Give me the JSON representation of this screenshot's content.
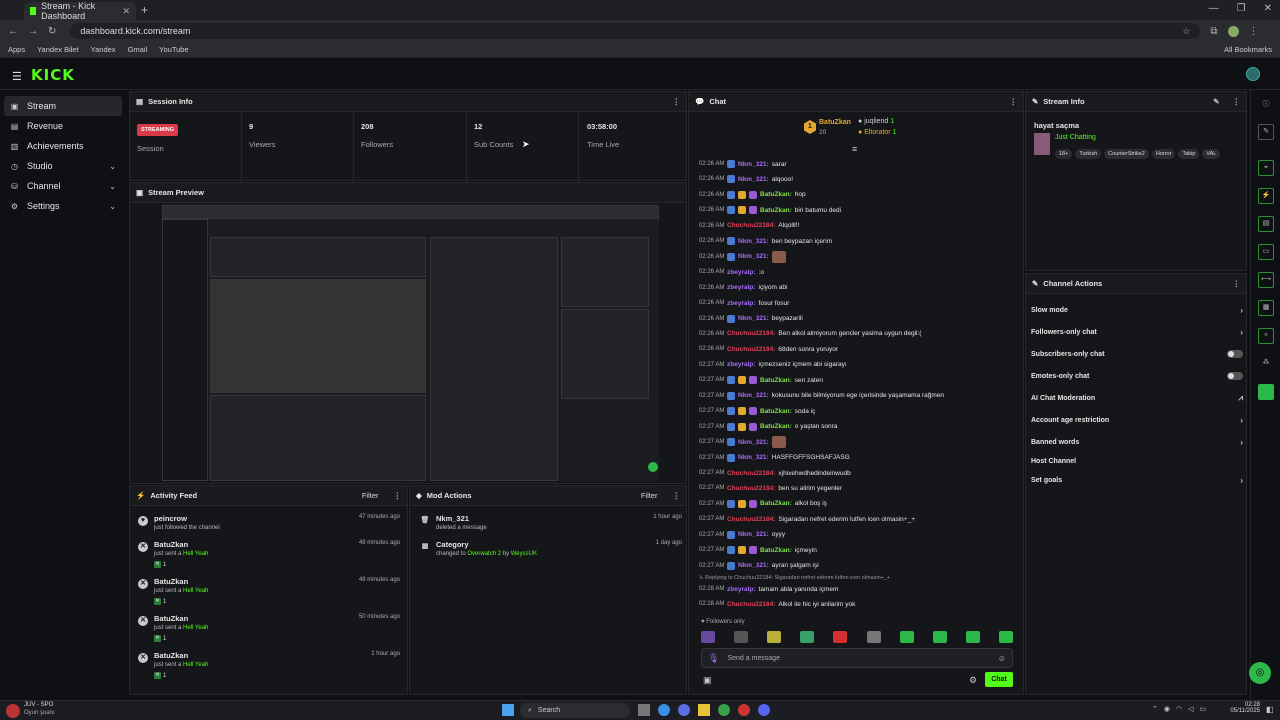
{
  "browser": {
    "tab_title": "Stream - Kick Dashboard",
    "url": "dashboard.kick.com/stream",
    "bookmarks": [
      "Apps",
      "Yandex Bilet",
      "Yandex",
      "Gmail",
      "YouTube"
    ],
    "all_bookmarks": "All Bookmarks"
  },
  "logo": "KICK",
  "sidebar": {
    "items": [
      {
        "label": "Stream",
        "icon": "video-icon"
      },
      {
        "label": "Revenue",
        "icon": "wallet-icon"
      },
      {
        "label": "Achievements",
        "icon": "trophy-icon"
      },
      {
        "label": "Studio",
        "icon": "studio-icon"
      },
      {
        "label": "Channel",
        "icon": "channel-icon"
      },
      {
        "label": "Settings",
        "icon": "gear-icon"
      }
    ]
  },
  "session": {
    "title": "Session Info",
    "badge": "STREAMING",
    "session_label": "Session",
    "stats": [
      {
        "value": "9",
        "label": "Viewers"
      },
      {
        "value": "208",
        "label": "Followers"
      },
      {
        "value": "12",
        "label": "Sub Counts"
      },
      {
        "value": "03:58:00",
        "label": "Time Live"
      }
    ]
  },
  "preview": {
    "title": "Stream Preview"
  },
  "activity": {
    "title": "Activity Feed",
    "filter": "Filter",
    "items": [
      {
        "name": "peincrow",
        "time": "47 minutes ago",
        "desc": "just followed the channel",
        "gift": "",
        "count": ""
      },
      {
        "name": "BatuZkan",
        "time": "49 minutes ago",
        "desc": "just sent a",
        "gift": "Hell Yeah",
        "count": "1"
      },
      {
        "name": "BatuZkan",
        "time": "49 minutes ago",
        "desc": "just sent a",
        "gift": "Hell Yeah",
        "count": "1"
      },
      {
        "name": "BatuZkan",
        "time": "50 minutes ago",
        "desc": "just sent a",
        "gift": "Hell Yeah",
        "count": "1"
      },
      {
        "name": "BatuZkan",
        "time": "1 hour ago",
        "desc": "just sent a",
        "gift": "Hell Yeah",
        "count": "1"
      }
    ]
  },
  "mod": {
    "title": "Mod Actions",
    "filter": "Filter",
    "items": [
      {
        "name": "Nkm_321",
        "time": "1 hour ago",
        "desc": "deleted a message"
      },
      {
        "name": "Category",
        "time": "1 day ago",
        "desc": "changed to",
        "game": "Overwatch 2",
        "by": "by",
        "user": "WeyssUK"
      }
    ]
  },
  "chat": {
    "title": "Chat",
    "leaders": [
      {
        "name": "BatuZkan",
        "count": "20"
      },
      {
        "name": "juqliend",
        "count": "1"
      },
      {
        "name": "Eltorator",
        "count": "1"
      }
    ],
    "messages": [
      {
        "time": "02:26 AM",
        "user": "Nkm_321",
        "color": "#a66cf0",
        "msg": "sarar",
        "badges": [
          "#4a7bd0"
        ]
      },
      {
        "time": "02:26 AM",
        "user": "Nkm_321",
        "color": "#a66cf0",
        "msg": "alqooo!",
        "badges": [
          "#4a7bd0"
        ]
      },
      {
        "time": "02:26 AM",
        "user": "BatuZkan",
        "color": "#7fe04d",
        "msg": "hop",
        "badges": [
          "#4a7bd0",
          "#e3a72f",
          "#9b59d6"
        ]
      },
      {
        "time": "02:26 AM",
        "user": "BatuZkan",
        "color": "#7fe04d",
        "msg": "biri batumu dedi",
        "badges": [
          "#4a7bd0",
          "#e3a72f",
          "#9b59d6"
        ]
      },
      {
        "time": "02:26 AM",
        "user": "Chuchuu22184",
        "color": "#e0405a",
        "msg": "Alqolll!!",
        "badges": []
      },
      {
        "time": "02:26 AM",
        "user": "Nkm_321",
        "color": "#a66cf0",
        "msg": "ben beypazarı içerim",
        "badges": [
          "#4a7bd0"
        ]
      },
      {
        "time": "02:26 AM",
        "user": "Nkm_321",
        "color": "#a66cf0",
        "msg": "",
        "badges": [
          "#4a7bd0"
        ],
        "emote": true
      },
      {
        "time": "02:26 AM",
        "user": "zbeyralp",
        "color": "#a66cf0",
        "msg": ":o",
        "badges": []
      },
      {
        "time": "02:26 AM",
        "user": "zbeyralp",
        "color": "#a66cf0",
        "msg": "içiyom abi",
        "badges": []
      },
      {
        "time": "02:26 AM",
        "user": "zbeyralp",
        "color": "#a66cf0",
        "msg": "fosur fosur",
        "badges": []
      },
      {
        "time": "02:26 AM",
        "user": "Nkm_321",
        "color": "#a66cf0",
        "msg": "beypazarili",
        "badges": [
          "#4a7bd0"
        ]
      },
      {
        "time": "02:26 AM",
        "user": "Chuchuu22184",
        "color": "#e0405a",
        "msg": "Ben alkol almiyorum gencler yasima uygun degil:(",
        "badges": []
      },
      {
        "time": "02:26 AM",
        "user": "Chuchuu22184",
        "color": "#e0405a",
        "msg": "68den sonra yoruyor",
        "badges": []
      },
      {
        "time": "02:27 AM",
        "user": "zbeyralp",
        "color": "#a66cf0",
        "msg": "içmezseniz içmem abi sigarayı",
        "badges": []
      },
      {
        "time": "02:27 AM",
        "user": "BatuZkan",
        "color": "#7fe04d",
        "msg": "sen zaten",
        "badges": [
          "#4a7bd0",
          "#e3a72f",
          "#9b59d6"
        ]
      },
      {
        "time": "02:27 AM",
        "user": "Nkm_321",
        "color": "#a66cf0",
        "msg": "kokusunu bile bilmiyorum ege içerisinde yaşamama rağmen",
        "badges": [
          "#4a7bd0"
        ]
      },
      {
        "time": "02:27 AM",
        "user": "BatuZkan",
        "color": "#7fe04d",
        "msg": "soda iç",
        "badges": [
          "#4a7bd0",
          "#e3a72f",
          "#9b59d6"
        ]
      },
      {
        "time": "02:27 AM",
        "user": "BatuZkan",
        "color": "#7fe04d",
        "msg": "o yaştan sonra",
        "badges": [
          "#4a7bd0",
          "#e3a72f",
          "#9b59d6"
        ]
      },
      {
        "time": "02:27 AM",
        "user": "Nkm_321",
        "color": "#a66cf0",
        "msg": "",
        "badges": [
          "#4a7bd0"
        ],
        "emote": true
      },
      {
        "time": "02:27 AM",
        "user": "Nkm_321",
        "color": "#a66cf0",
        "msg": "HASFFGFFSGHSAFJASG",
        "badges": [
          "#4a7bd0"
        ]
      },
      {
        "time": "02:27 AM",
        "user": "Chuchuu22184",
        "color": "#e0405a",
        "msg": "xjhixehwdhedindeinwudb",
        "badges": []
      },
      {
        "time": "02:27 AM",
        "user": "Chuchuu22184",
        "color": "#e0405a",
        "msg": "ben su alirim yegenler",
        "badges": []
      },
      {
        "time": "02:27 AM",
        "user": "BatuZkan",
        "color": "#7fe04d",
        "msg": "alkol boş iş",
        "badges": [
          "#4a7bd0",
          "#e3a72f",
          "#9b59d6"
        ]
      },
      {
        "time": "02:27 AM",
        "user": "Chuchuu22184",
        "color": "#e0405a",
        "msg": "Sigaradan nefret ederim lutfen icen olmasin+_+",
        "badges": []
      },
      {
        "time": "02:27 AM",
        "user": "Nkm_321",
        "color": "#a66cf0",
        "msg": "oyyy",
        "badges": [
          "#4a7bd0"
        ]
      },
      {
        "time": "02:27 AM",
        "user": "BatuZkan",
        "color": "#7fe04d",
        "msg": "içmeyin",
        "badges": [
          "#4a7bd0",
          "#e3a72f",
          "#9b59d6"
        ]
      },
      {
        "time": "02:27 AM",
        "user": "Nkm_321",
        "color": "#a66cf0",
        "msg": "ayran şalgam işi",
        "badges": [
          "#4a7bd0"
        ]
      }
    ],
    "reply_to": "Replying to Chuchuu22184: Sigaradan nefret ederim lutfen icen olmasin+_+",
    "reply": {
      "time": "02:28 AM",
      "user": "zbeyralp",
      "color": "#a66cf0",
      "msg": "tamam abla yanında içmem"
    },
    "last": {
      "time": "02:28 AM",
      "user": "Chuchuu22184",
      "color": "#e0405a",
      "msg": "Alkol ile hic iyi anilarim yok"
    },
    "mode": "Followers only",
    "input_placeholder": "Send a message",
    "send": "Chat"
  },
  "streaminfo": {
    "title": "Stream Info",
    "stream_title": "hayat saçma",
    "category": "Just Chatting",
    "tags": [
      "18+",
      "Turkish",
      "CounterStrike2",
      "Horror",
      "Takip",
      "VAL"
    ]
  },
  "actions": {
    "title": "Channel Actions",
    "items": [
      {
        "label": "Slow mode",
        "ctrl": "chev"
      },
      {
        "label": "Followers-only chat",
        "ctrl": "chev"
      },
      {
        "label": "Subscribers-only chat",
        "ctrl": "toggle"
      },
      {
        "label": "Emotes-only chat",
        "ctrl": "toggle"
      },
      {
        "label": "AI Chat Moderation",
        "ctrl": "chart"
      },
      {
        "label": "Account age restriction",
        "ctrl": "chev"
      },
      {
        "label": "Banned words",
        "ctrl": "chev"
      },
      {
        "label": "Host Channel",
        "ctrl": "none"
      },
      {
        "label": "Set goals",
        "ctrl": "chev"
      }
    ]
  },
  "taskbar": {
    "weather_title": "JUV - SPO",
    "weather_sub": "Oyun şuanı",
    "search": "Search",
    "time": "02:28",
    "date": "05/11/2025"
  },
  "colors": {
    "accent": "#53fc18",
    "streaming": "#d93a4a"
  }
}
